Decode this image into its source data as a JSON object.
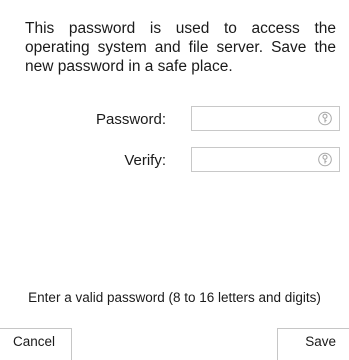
{
  "description": "This password is used to access the operating system and file server. Save the new password in a safe place.",
  "fields": {
    "password": {
      "label": "Password:",
      "value": "",
      "icon": "key-icon"
    },
    "verify": {
      "label": "Verify:",
      "value": "",
      "icon": "key-icon"
    }
  },
  "hint": "Enter a valid password (8 to 16 letters and digits)",
  "buttons": {
    "cancel": "Cancel",
    "save": "Save"
  }
}
